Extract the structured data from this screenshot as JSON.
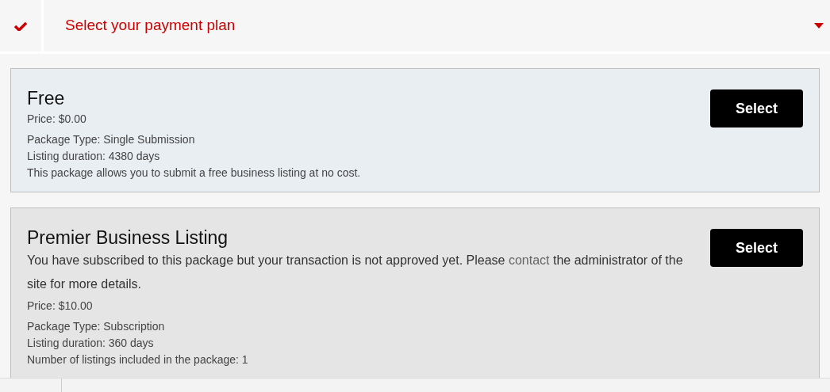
{
  "step": {
    "title": "Select your payment plan",
    "completed": true,
    "expanded": true
  },
  "plans": [
    {
      "name": "Free",
      "selected": true,
      "price": "Price: $0.00",
      "details": [
        "Package Type: Single Submission",
        "Listing duration: 4380 days",
        "This package allows you to submit a free business listing at no cost."
      ],
      "button": "Select"
    },
    {
      "name": "Premier Business Listing",
      "selected": false,
      "message": {
        "before": "You have subscribed to this package but your transaction is not approved yet. Please",
        "link": "contact",
        "after": "the administrator of the site for more details."
      },
      "price": "Price: $10.00",
      "details": [
        "Package Type: Subscription",
        "Listing duration: 360 days",
        "Number of listings included in the package:  1"
      ],
      "button": "Select"
    }
  ]
}
